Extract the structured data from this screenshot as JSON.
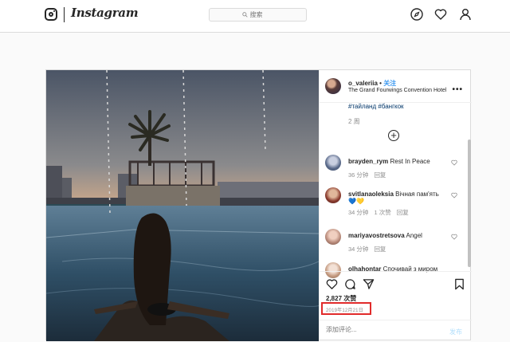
{
  "header": {
    "wordmark": "Instagram",
    "search_placeholder": "搜索",
    "icons": [
      "instagram-glyph-icon",
      "search-icon",
      "explore-compass-icon",
      "activity-heart-icon",
      "profile-person-icon"
    ]
  },
  "post": {
    "username": "o_valeriia",
    "follow_label": "关注",
    "location": "The Grand Fourwings Convention Hotel",
    "more_label": "•••",
    "caption_hashtags": "#тайланд #бангкок",
    "caption_time": "2 周",
    "load_more_label": "+",
    "comments": [
      {
        "user": "brayden_rym",
        "text": "Rest In Peace",
        "time": "36 分钟",
        "likes": "",
        "reply": "回复"
      },
      {
        "user": "svitlanaoleksia",
        "text": "Вічная пам'ять",
        "emoji": "💙💛",
        "time": "34 分钟",
        "likes": "1 次赞",
        "reply": "回复"
      },
      {
        "user": "mariyavostretsova",
        "text": "Angel",
        "time": "34 分钟",
        "likes": "",
        "reply": "回复"
      },
      {
        "user": "olhahontar",
        "text": "Спочивай з миром",
        "time": "",
        "likes": "",
        "reply": ""
      }
    ],
    "likes_count": "2,827",
    "likes_label": "次赞",
    "date": "2019年12月21日",
    "comment_placeholder": "添加评论...",
    "post_button": "发布",
    "colors": {
      "link": "#3897f0",
      "hashtag": "#003569",
      "highlight_box": "#e12b2b",
      "post_button_disabled": "#b2dffc"
    }
  }
}
